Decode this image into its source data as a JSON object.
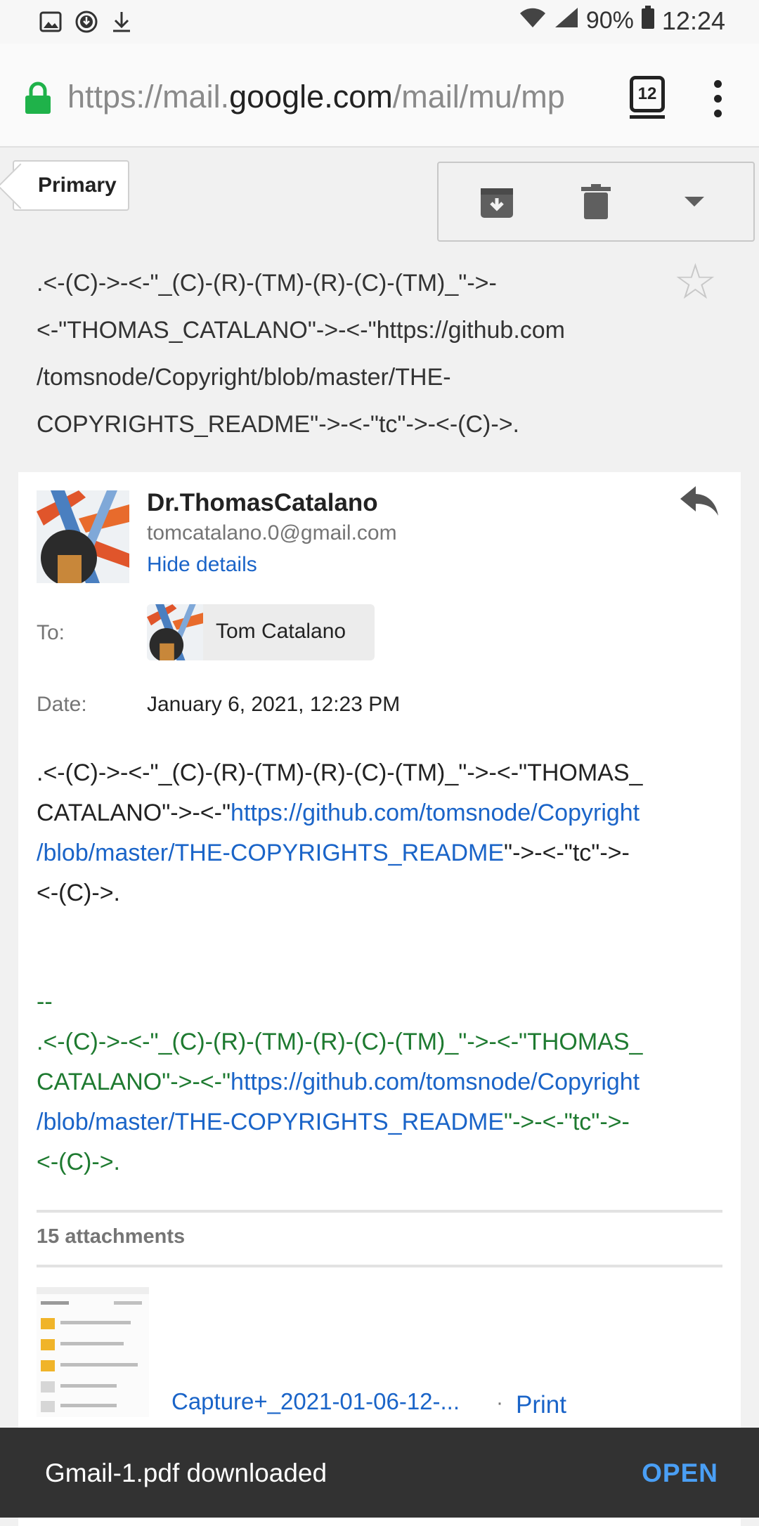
{
  "status_bar": {
    "battery": "90%",
    "time": "12:24",
    "icons": [
      "image-icon",
      "download-status-icon",
      "download-icon",
      "wifi-icon",
      "signal-icon",
      "battery-icon"
    ]
  },
  "browser": {
    "url_prefix": "https://mail.",
    "url_host": "google.com",
    "url_path": "/mail/mu/mp",
    "tab_count": "12"
  },
  "toolbar": {
    "back_label": "Primary",
    "actions": [
      "archive-icon",
      "delete-icon",
      "more-dropdown-icon"
    ]
  },
  "subject": {
    "lines": [
      ".<-(C)->-<-\"_(C)-(R)-(TM)-(R)-(C)-(TM)_\"->-",
      "<-\"THOMAS_CATALANO\"->-<-\"https://github.com",
      "/tomsnode/Copyright/blob/master/THE-",
      "COPYRIGHTS_README\"->-<-\"tc\"->-<-(C)->."
    ]
  },
  "message": {
    "sender_name": "Dr.ThomasCatalano",
    "sender_email": "tomcatalano.0@gmail.com",
    "hide_details": "Hide details",
    "to_label": "To:",
    "to_name": "Tom Catalano",
    "date_label": "Date:",
    "date_value": "January 6, 2021, 12:23 PM",
    "body_line1": ".<-(C)->-<-\"_(C)-(R)-(TM)-(R)-(C)-(TM)_\"->-<-\"THOMAS_",
    "body_line2_pre": "CATALANO\"->-<-\"",
    "body_link1": "https://github.com/tomsnode/Copyright",
    "body_link2": "/blob/master/THE-COPYRIGHTS_README",
    "body_line3_post": "\"->-<-\"tc\"->-",
    "body_line4": "<-(C)->.",
    "sig_dash": "--",
    "sig_line1": ".<-(C)->-<-\"_(C)-(R)-(TM)-(R)-(C)-(TM)_\"->-<-\"THOMAS_",
    "sig_line2_pre": "CATALANO\"->-<-\"",
    "sig_link1": "https://github.com/tomsnode/Copyright",
    "sig_link2": "/blob/master/THE-COPYRIGHTS_README",
    "sig_line3_post": "\"->-<-\"tc\"->-",
    "sig_line4": "<-(C)->."
  },
  "attachments": {
    "count_label": "15 attachments",
    "first_name": "Capture+_2021-01-06-12-...",
    "separator": "·",
    "print_label": "Print"
  },
  "snackbar": {
    "message": "Gmail-1.pdf downloaded",
    "action": "OPEN"
  },
  "colors": {
    "link": "#1a64c8",
    "signature": "#1e7a30",
    "lock": "#1fb24a",
    "snackbar_action": "#4a9ff5"
  }
}
